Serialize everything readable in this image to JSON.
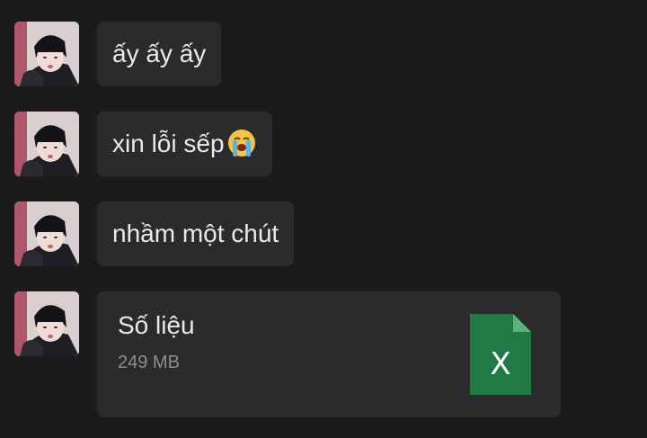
{
  "messages": [
    {
      "text": "ấy ấy ấy",
      "emoji": ""
    },
    {
      "text": "xin lỗi sếp",
      "emoji": "loudly-crying-face-icon"
    },
    {
      "text": "nhầm một chút",
      "emoji": ""
    }
  ],
  "file": {
    "name": "Số liệu",
    "size": "249 MB",
    "icon": "excel-file-icon",
    "icon_letter": "X",
    "icon_color": "#1f7a44"
  },
  "colors": {
    "background": "#1b1b1c",
    "bubble": "#2b2b2d",
    "text": "#e9e9ea",
    "muted": "#8d8d90"
  }
}
